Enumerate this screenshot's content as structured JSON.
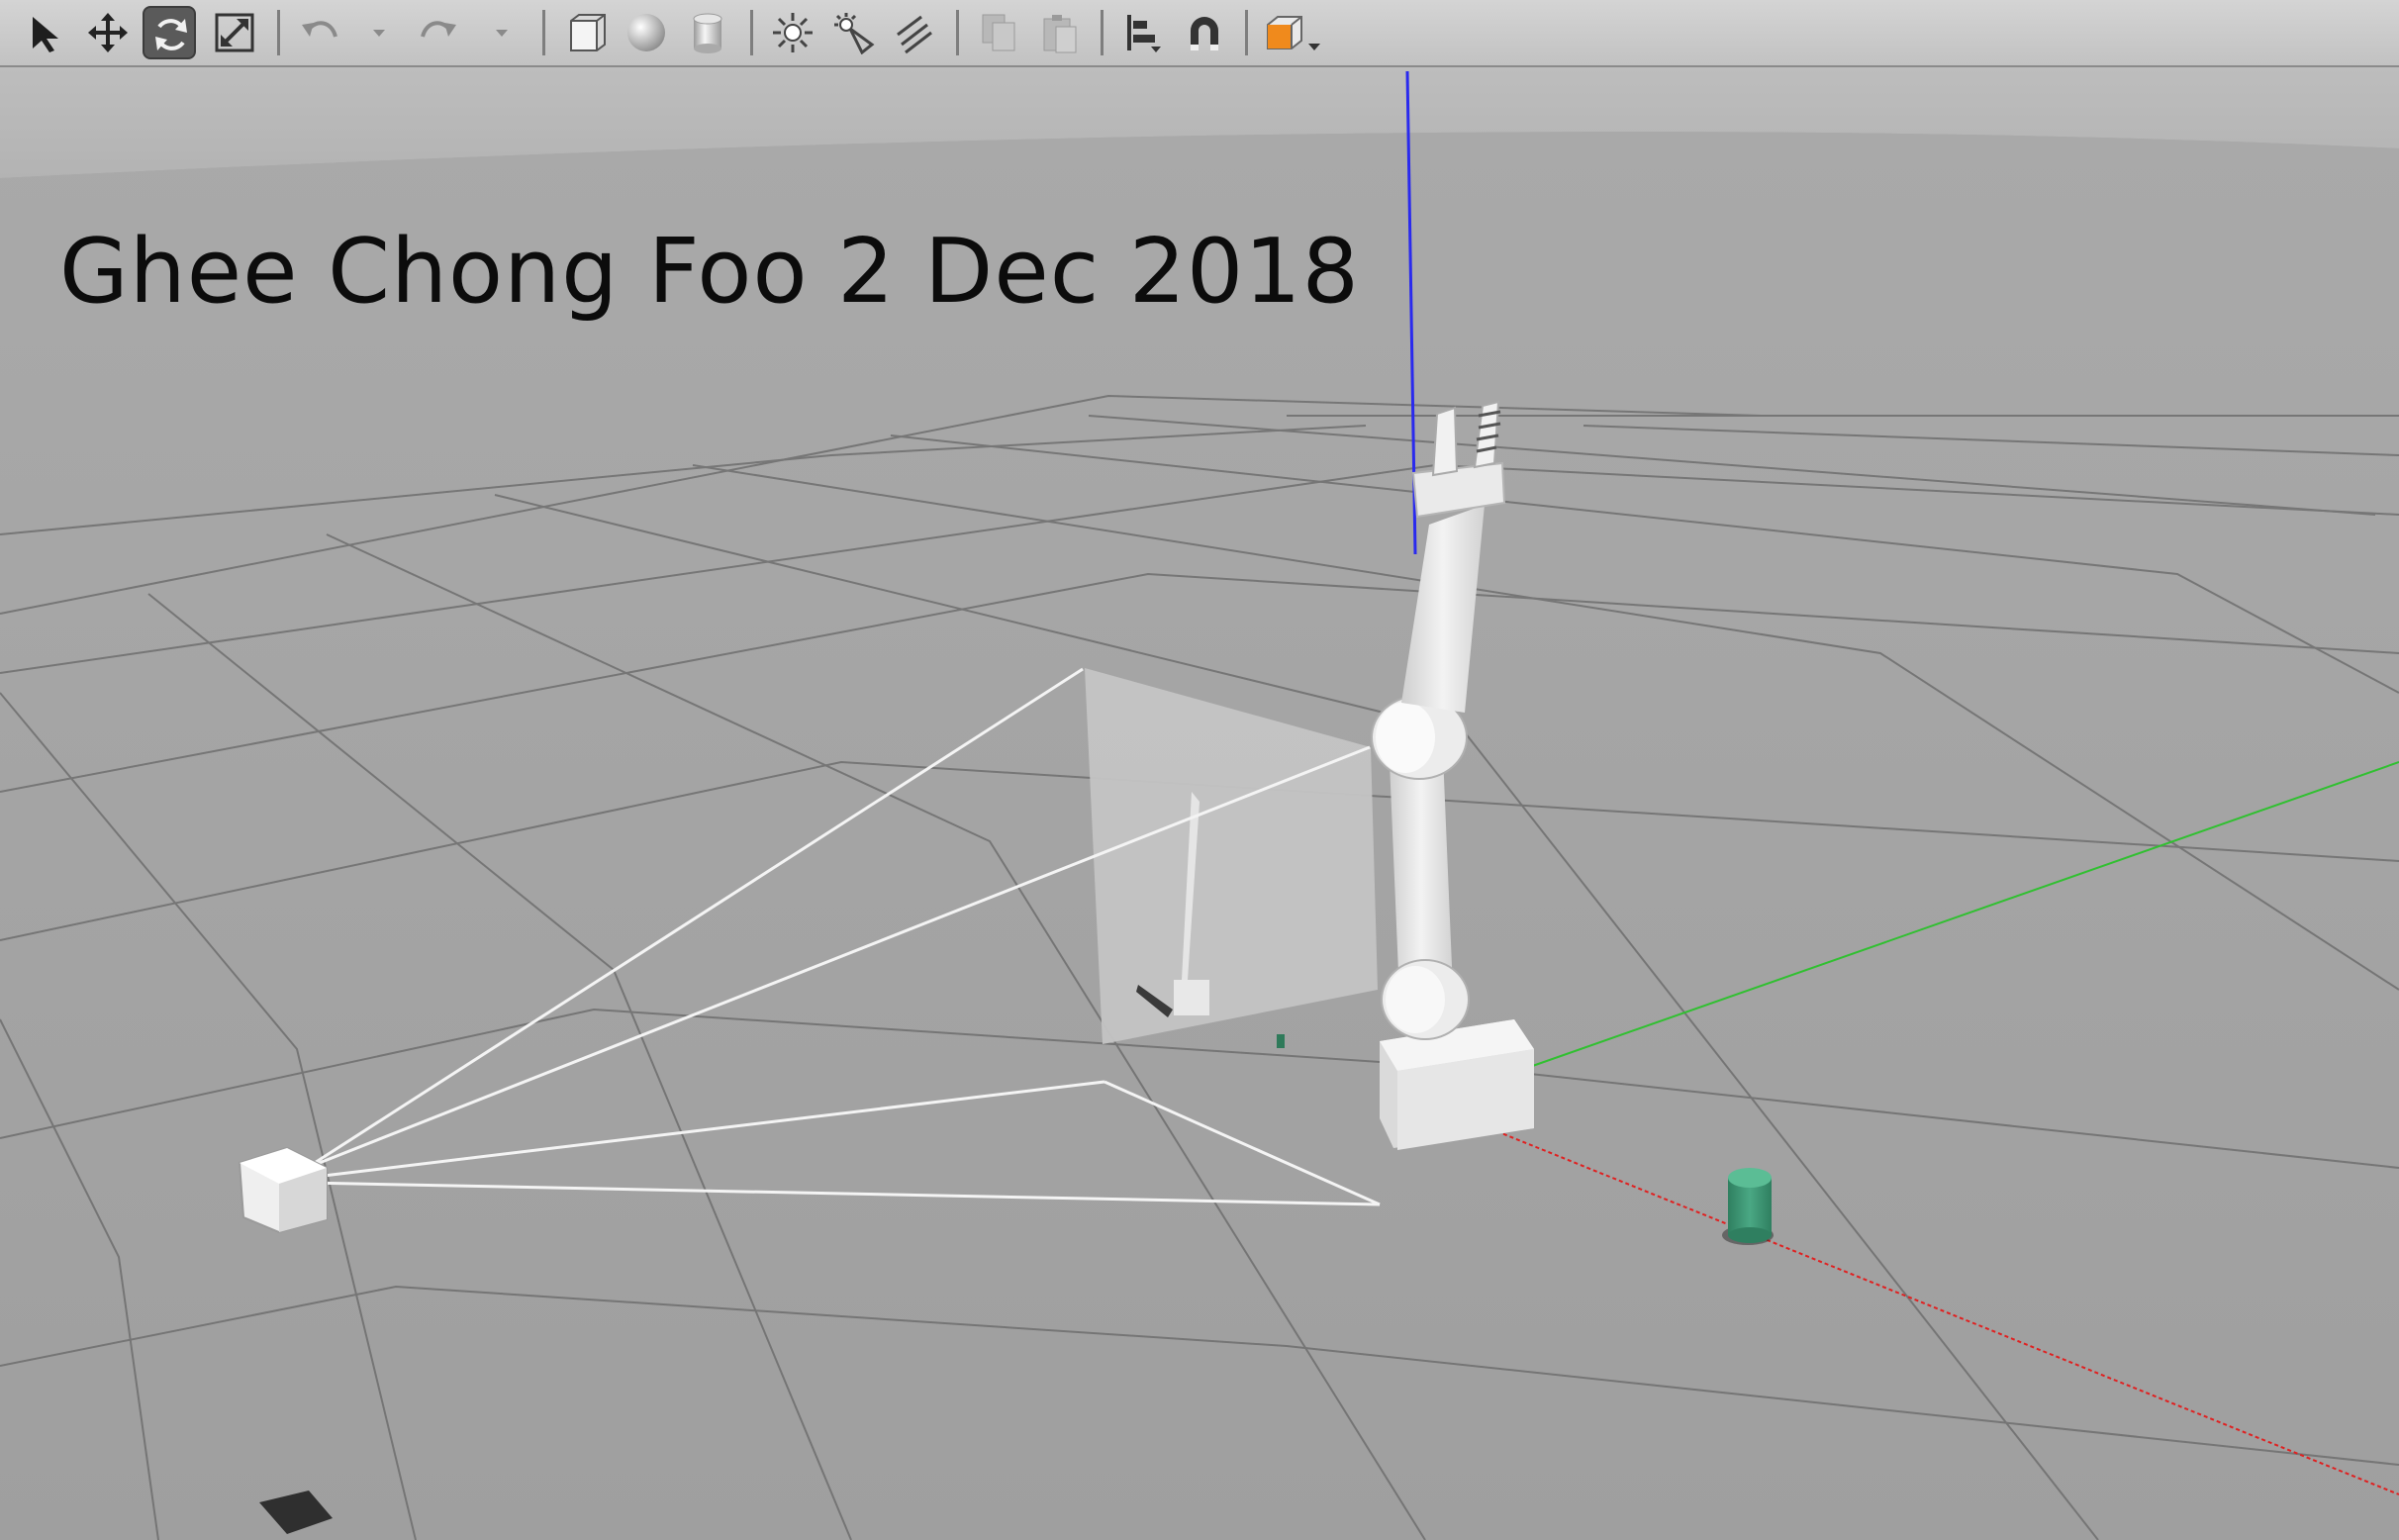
{
  "window": {
    "caption": "Ghee Chong Foo 2 Dec 2018"
  },
  "toolbar": {
    "tools": [
      {
        "icon": "select-arrow-icon",
        "active": false
      },
      {
        "icon": "translate-icon",
        "active": false
      },
      {
        "icon": "rotate-icon",
        "active": true
      },
      {
        "icon": "scale-icon",
        "active": false
      },
      {
        "icon": "undo-icon",
        "enabled": false
      },
      {
        "icon": "redo-icon",
        "enabled": false
      },
      {
        "icon": "box-shape-icon"
      },
      {
        "icon": "sphere-shape-icon"
      },
      {
        "icon": "cylinder-shape-icon"
      },
      {
        "icon": "point-light-icon"
      },
      {
        "icon": "spot-light-icon"
      },
      {
        "icon": "directional-light-icon"
      },
      {
        "icon": "copy-icon",
        "enabled": false
      },
      {
        "icon": "paste-icon",
        "enabled": false
      },
      {
        "icon": "align-icon"
      },
      {
        "icon": "snap-magnet-icon"
      },
      {
        "icon": "view-angle-icon"
      }
    ]
  },
  "scene": {
    "background_color": "#a3a3a3",
    "sky_color": "#b8b9b8",
    "grid_color": "#6e6e6e",
    "axis_colors": {
      "x": "#e02020",
      "y": "#30c030",
      "z": "#2a2aee"
    },
    "objects": [
      {
        "name": "robot-arm",
        "color": "#e8e8e8"
      },
      {
        "name": "camera-sensor",
        "color": "#e8e8e8"
      },
      {
        "name": "camera-image-plane",
        "color": "#c4c4c4"
      },
      {
        "name": "green-cylinder",
        "color": "#3e9a76"
      },
      {
        "name": "table-shadow",
        "color": "#333333"
      }
    ]
  }
}
